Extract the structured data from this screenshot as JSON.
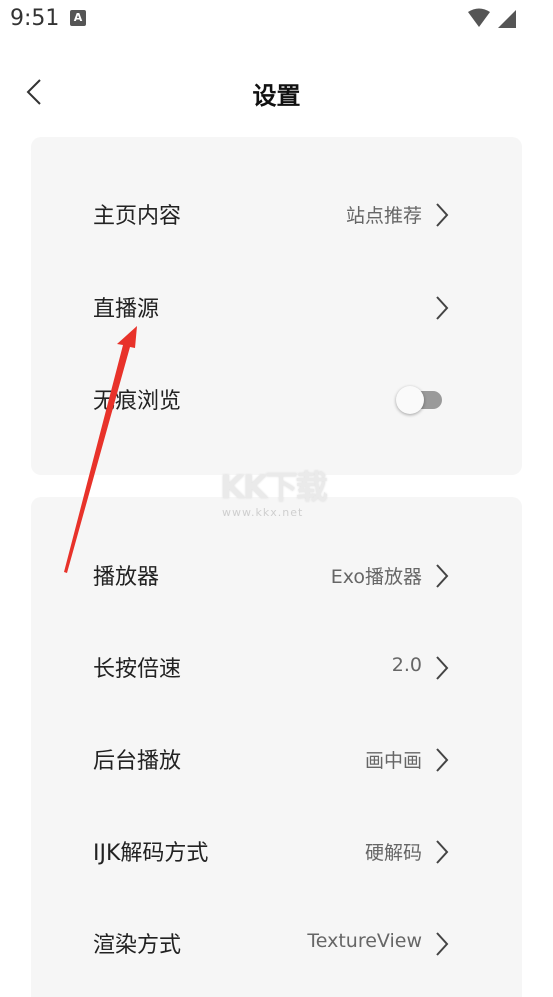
{
  "status": {
    "time": "9:51",
    "notification": "A"
  },
  "header": {
    "title": "设置",
    "back_icon": "chevron-left-icon"
  },
  "group1": {
    "rows": [
      {
        "label": "主页内容",
        "value": "站点推荐"
      },
      {
        "label": "直播源",
        "value": ""
      },
      {
        "label": "无痕浏览",
        "toggle": false
      }
    ]
  },
  "group2": {
    "rows": [
      {
        "label": "播放器",
        "value": "Exo播放器"
      },
      {
        "label": "长按倍速",
        "value": "2.0"
      },
      {
        "label": "后台播放",
        "value": "画中画"
      },
      {
        "label": "IJK解码方式",
        "value": "硬解码"
      },
      {
        "label": "渲染方式",
        "value": "TextureView"
      }
    ]
  },
  "watermark": {
    "logo": "KK下载",
    "url": "www.kkx.net"
  },
  "colors": {
    "annotation_arrow": "#e8322a",
    "card_bg": "#f6f6f6",
    "toggle_track": "#9a9a9a"
  }
}
